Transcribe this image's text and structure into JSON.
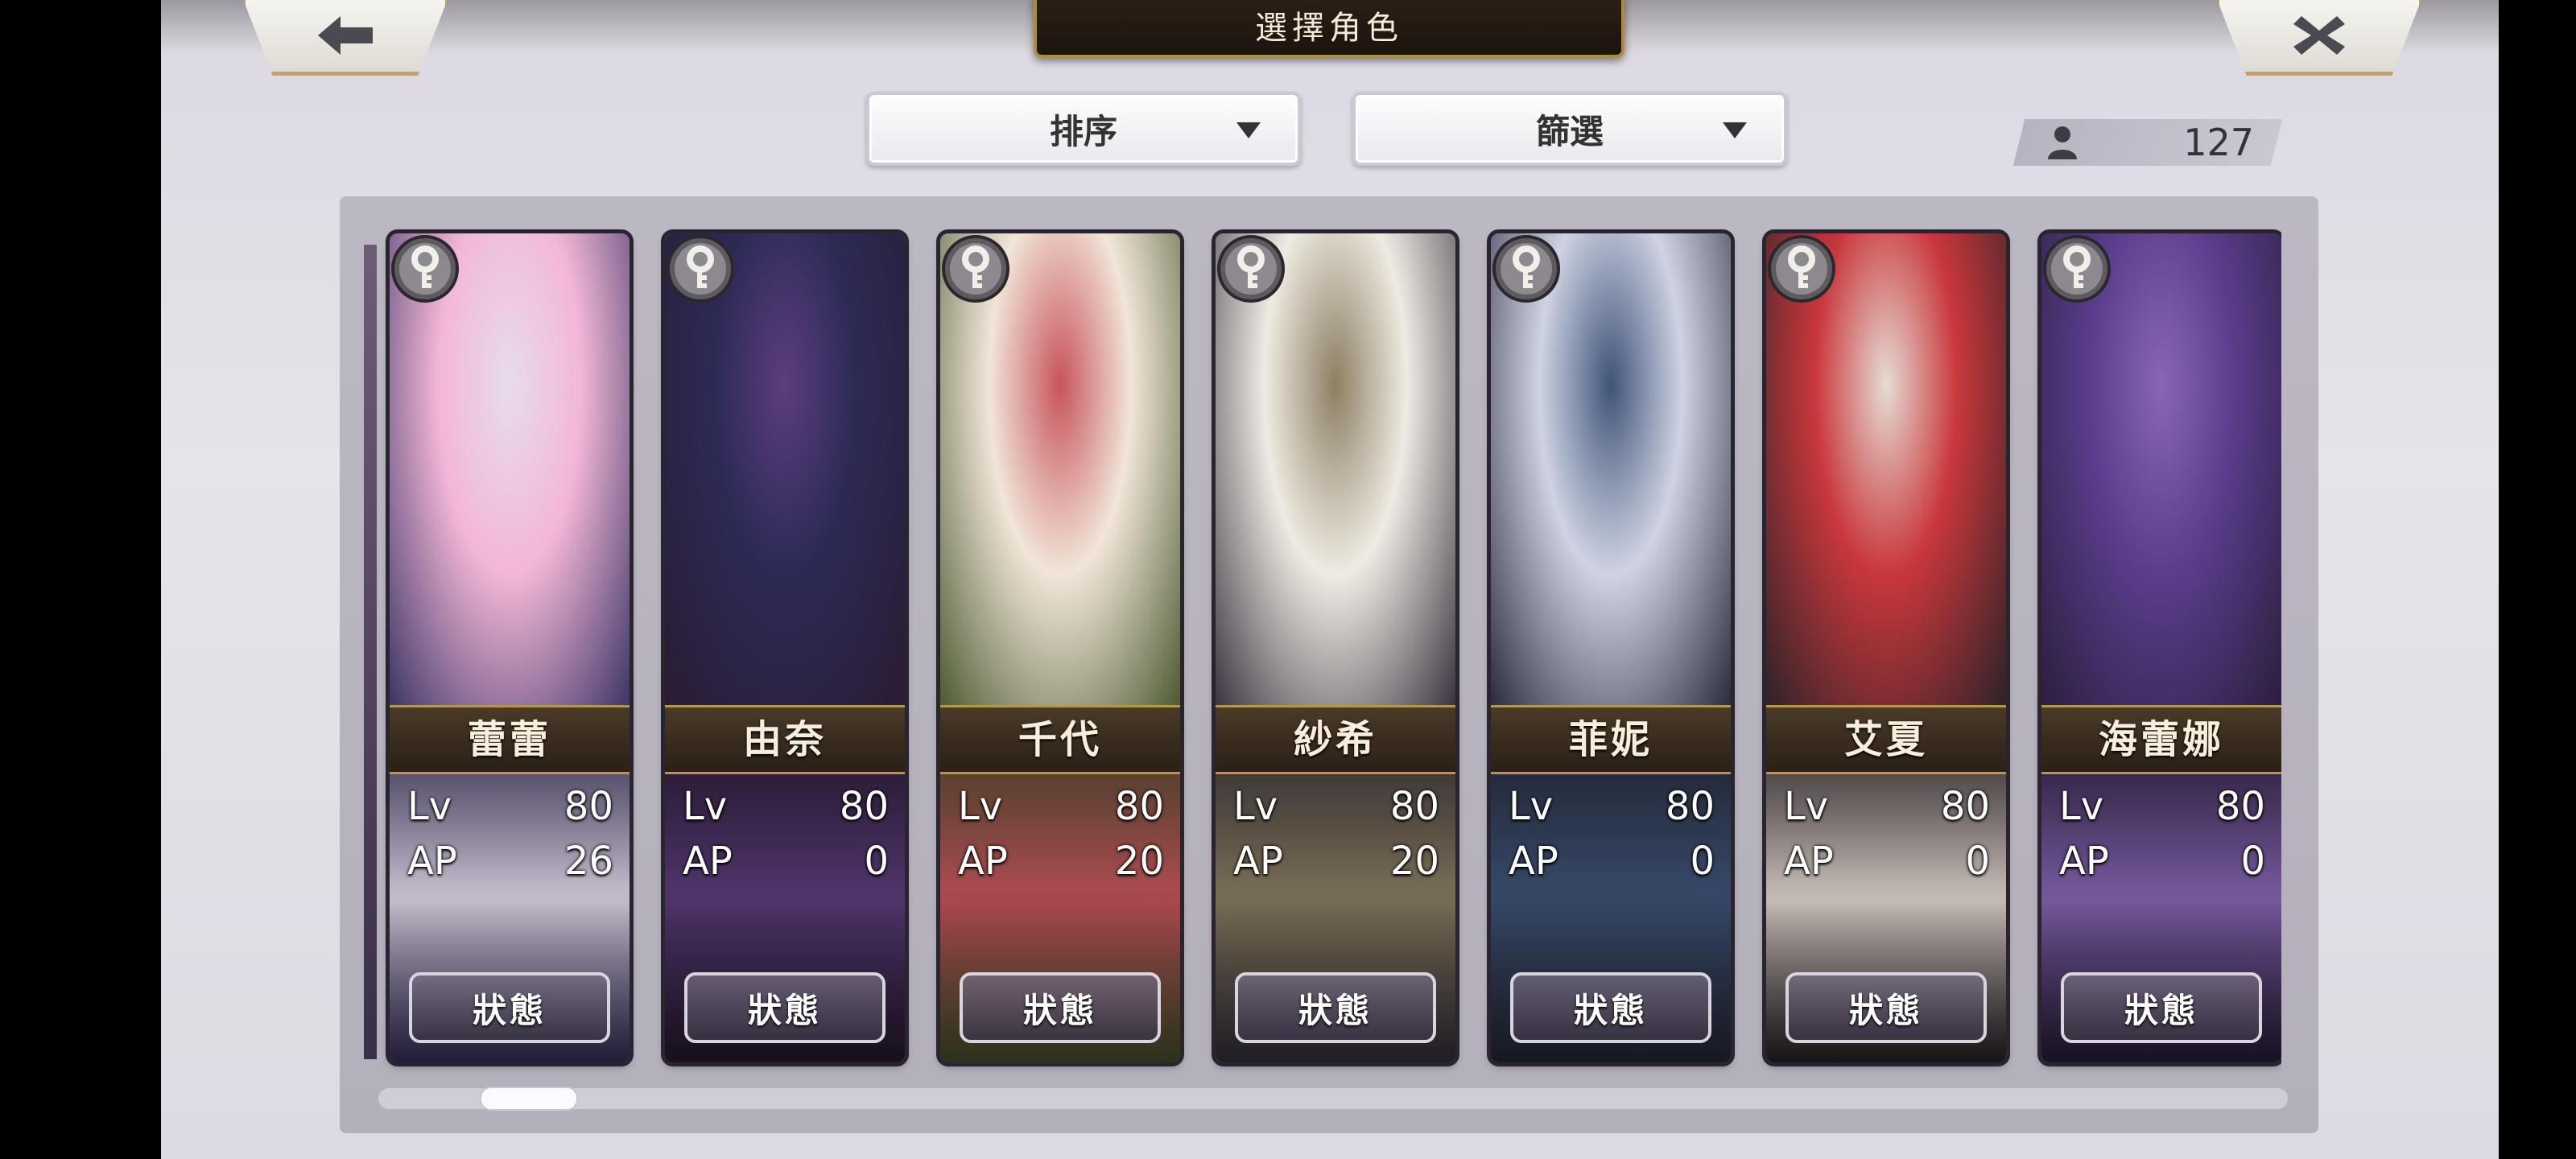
{
  "header": {
    "title": "選擇角色",
    "back_icon": "arrow-left-icon",
    "close_icon": "close-x-icon"
  },
  "controls": {
    "sort_label": "排序",
    "filter_label": "篩選"
  },
  "roster": {
    "count": "127",
    "count_icon": "person-icon"
  },
  "cards": [
    {
      "name": "蕾蕾",
      "lv_label": "Lv",
      "lv": "80",
      "ap_label": "AP",
      "ap": "26",
      "button": "狀態",
      "palette": [
        "#f3b7d6",
        "#e7dcec",
        "#3b3566"
      ]
    },
    {
      "name": "由奈",
      "lv_label": "Lv",
      "lv": "80",
      "ap_label": "AP",
      "ap": "0",
      "button": "狀態",
      "palette": [
        "#2c2a55",
        "#5b3d7d",
        "#2a1c32"
      ]
    },
    {
      "name": "千代",
      "lv_label": "Lv",
      "lv": "80",
      "ap_label": "AP",
      "ap": "20",
      "button": "狀態",
      "palette": [
        "#f1e6d8",
        "#c8545c",
        "#4d5a32"
      ]
    },
    {
      "name": "紗希",
      "lv_label": "Lv",
      "lv": "80",
      "ap_label": "AP",
      "ap": "20",
      "button": "狀態",
      "palette": [
        "#efebe3",
        "#8c7f62",
        "#3a3440"
      ]
    },
    {
      "name": "菲妮",
      "lv_label": "Lv",
      "lv": "80",
      "ap_label": "AP",
      "ap": "0",
      "button": "狀態",
      "palette": [
        "#cfd3e3",
        "#3f5478",
        "#2a2c3c"
      ]
    },
    {
      "name": "艾夏",
      "lv_label": "Lv",
      "lv": "80",
      "ap_label": "AP",
      "ap": "0",
      "button": "狀態",
      "palette": [
        "#c9373b",
        "#e6dcd4",
        "#2c2328"
      ]
    },
    {
      "name": "海蕾娜",
      "lv_label": "Lv",
      "lv": "80",
      "ap_label": "AP",
      "ap": "0",
      "button": "狀態",
      "palette": [
        "#5a3d8c",
        "#8867b5",
        "#2b1f3d"
      ]
    }
  ],
  "icons": {
    "lock": "lock-key-icon"
  }
}
